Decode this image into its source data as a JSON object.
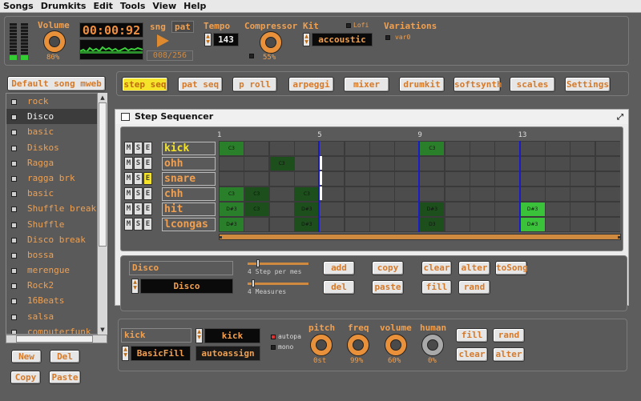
{
  "menu": [
    "Songs",
    "Drumkits",
    "Edit",
    "Tools",
    "View",
    "Help"
  ],
  "transport": {
    "volume_label": "Volume",
    "volume_value": "80%",
    "time": "00:00:92",
    "sng_label": "sng",
    "pat_label": "pat",
    "position": "008/256",
    "tempo_label": "Tempo",
    "tempo_value": "143",
    "compressor_label": "Compressor",
    "compressor_value": "55%",
    "kit_label": "Kit",
    "kit_value": "accoustic",
    "lofi_label": "Lofi",
    "variations_label": "Variations",
    "variation_item": "var0"
  },
  "song_button": "Default song mweb",
  "songs": [
    "rock",
    "Disco",
    "basic",
    "Diskos",
    "Ragga",
    "ragga brk",
    "basic",
    "Shuffle break",
    "Shuffle",
    "Disco break",
    "bossa",
    "merengue",
    "Rock2",
    "16Beats",
    "salsa",
    "computerfunk"
  ],
  "selected_song_index": 1,
  "song_actions": {
    "new": "New",
    "del": "Del",
    "copy": "Copy",
    "paste": "Paste"
  },
  "tabs": [
    "step seq",
    "pat seq",
    "p roll",
    "arpeggi",
    "mixer",
    "drumkit",
    "softsynth",
    "scales",
    "Settings"
  ],
  "active_tab_index": 0,
  "window": {
    "title": "Step Sequencer"
  },
  "sequencer": {
    "step_numbers": [
      "1",
      "5",
      "9",
      "13"
    ],
    "mse_labels": [
      "M",
      "S",
      "E"
    ],
    "tracks": [
      {
        "name": "kick",
        "notes": [
          {
            "step": 0,
            "label": "C3"
          },
          {
            "step": 8,
            "label": "C3"
          }
        ]
      },
      {
        "name": "ohh",
        "notes": [
          {
            "step": 2,
            "label": "C3"
          }
        ]
      },
      {
        "name": "snare",
        "notes": []
      },
      {
        "name": "chh",
        "notes": [
          {
            "step": 0,
            "label": "C3"
          },
          {
            "step": 1,
            "label": "C3"
          },
          {
            "step": 3,
            "label": "C3"
          }
        ]
      },
      {
        "name": "hit",
        "notes": [
          {
            "step": 0,
            "label": "D#3"
          },
          {
            "step": 1,
            "label": "C3"
          },
          {
            "step": 3,
            "label": "D#3"
          },
          {
            "step": 8,
            "label": "D#3"
          },
          {
            "step": 12,
            "label": "D#3"
          }
        ]
      },
      {
        "name": "lcongas",
        "notes": [
          {
            "step": 0,
            "label": "D#3"
          },
          {
            "step": 3,
            "label": "D#3"
          },
          {
            "step": 8,
            "label": "D3"
          },
          {
            "step": 12,
            "label": "D#3"
          }
        ]
      }
    ]
  },
  "pattern": {
    "name_field": "Disco",
    "name_display": "Disco",
    "step_per_mes": "4 Step per mes",
    "measures": "4 Measures",
    "buttons": [
      "add",
      "copy",
      "clear",
      "alter",
      "toSong",
      "del",
      "paste",
      "fill",
      "rand"
    ]
  },
  "instrument": {
    "name_field": "kick",
    "name_display": "kick",
    "fill_mode": "BasicFill",
    "autoassign": "autoassign",
    "autopa_label": "autopa",
    "mono_label": "mono",
    "pitch_label": "pitch",
    "pitch_value": "0st",
    "freq_label": "freq",
    "freq_value": "99%",
    "volume_label": "volume",
    "volume_value": "60%",
    "human_label": "human",
    "human_value": "0%",
    "buttons": [
      "fill",
      "rand",
      "clear",
      "alter"
    ]
  }
}
